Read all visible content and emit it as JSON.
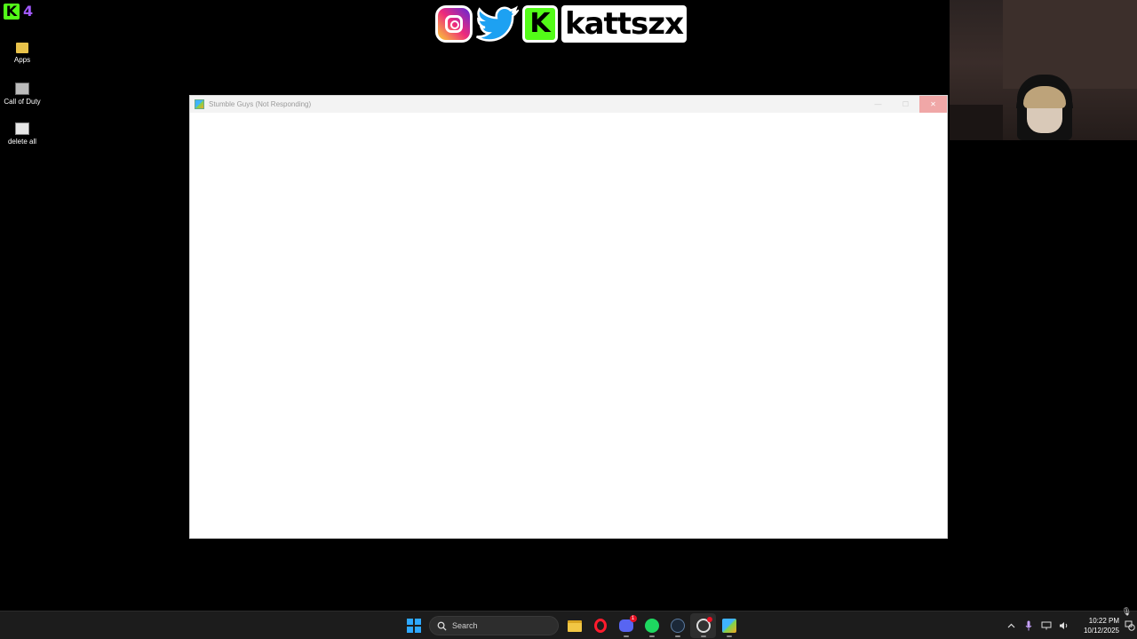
{
  "overlay": {
    "kick_count": "4",
    "social_handle": "kattszx"
  },
  "desktop": {
    "icons": [
      {
        "label": "Apps",
        "icon": "folder-icon"
      },
      {
        "label": "Call of Duty",
        "icon": "game-shortcut-icon"
      },
      {
        "label": "delete all",
        "icon": "file-shortcut-icon"
      }
    ]
  },
  "window": {
    "title": "Stumble Guys (Not Responding)",
    "controls": {
      "minimize": "—",
      "maximize": "☐",
      "close": "✕"
    }
  },
  "taskbar": {
    "search_label": "Search",
    "discord_badge": "1",
    "clock_time": "10:22 PM",
    "clock_date": "10/12/2025",
    "apps": [
      "start",
      "search",
      "file-explorer",
      "opera",
      "discord",
      "spotify",
      "steam",
      "obs",
      "stumble-guys"
    ]
  },
  "colors": {
    "kick_green": "#53fc18",
    "kick_purple": "#a259ff",
    "windows_blue": "#2ea8ff",
    "close_hover": "#f0a7a7"
  }
}
